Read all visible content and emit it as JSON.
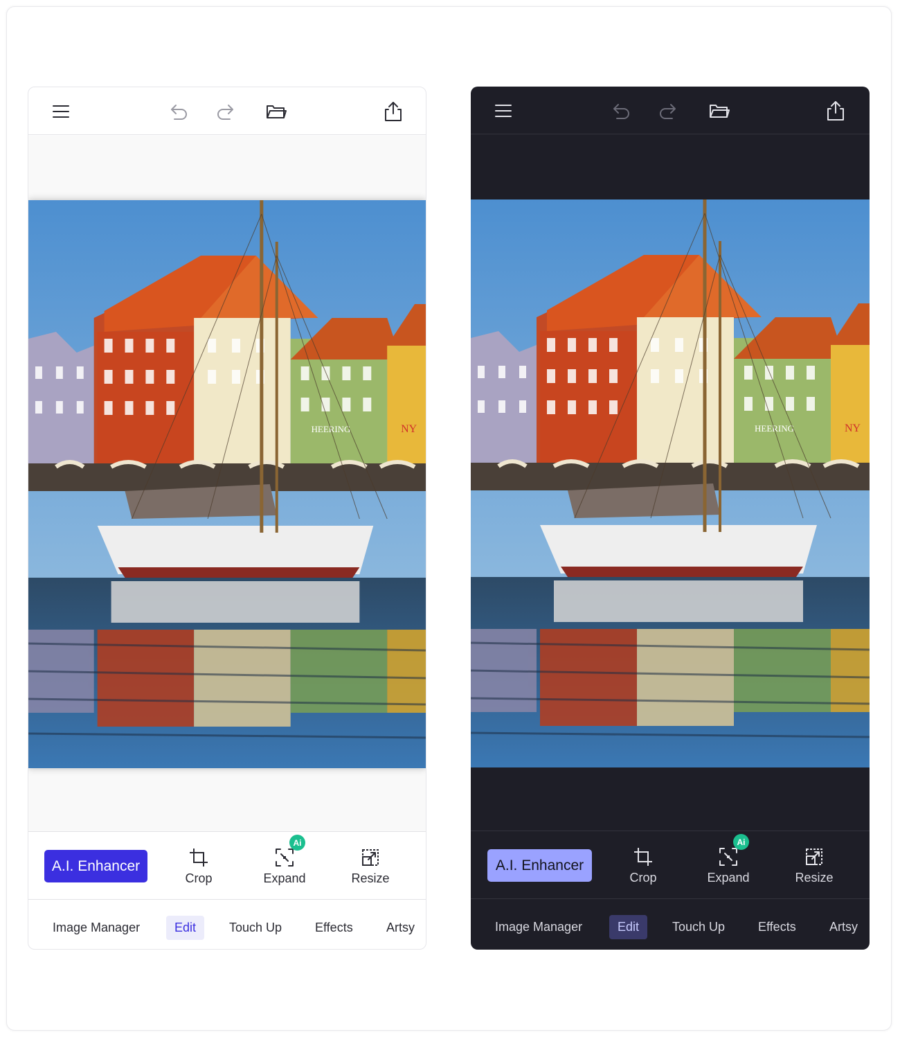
{
  "panels": [
    {
      "theme": "light",
      "icons": [
        "menu-icon",
        "undo-icon",
        "redo-icon",
        "open-folder-icon",
        "share-icon"
      ],
      "ai_enhancer_label": "A.I. Enhancer",
      "tools": [
        {
          "label": "Crop",
          "icon": "crop-icon"
        },
        {
          "label": "Expand",
          "icon": "expand-icon",
          "badge": "Ai"
        },
        {
          "label": "Resize",
          "icon": "resize-icon"
        }
      ],
      "nav": [
        {
          "label": "Image Manager"
        },
        {
          "label": "Edit",
          "active": true
        },
        {
          "label": "Touch Up"
        },
        {
          "label": "Effects"
        },
        {
          "label": "Artsy"
        }
      ],
      "colors": {
        "accent": "#3b2fe0",
        "ai_badge": "#1bbf8f",
        "background": "#ffffff"
      }
    },
    {
      "theme": "dark",
      "icons": [
        "menu-icon",
        "undo-icon",
        "redo-icon",
        "open-folder-icon",
        "share-icon"
      ],
      "ai_enhancer_label": "A.I. Enhancer",
      "tools": [
        {
          "label": "Crop",
          "icon": "crop-icon"
        },
        {
          "label": "Expand",
          "icon": "expand-icon",
          "badge": "Ai"
        },
        {
          "label": "Resize",
          "icon": "resize-icon"
        }
      ],
      "nav": [
        {
          "label": "Image Manager"
        },
        {
          "label": "Edit",
          "active": true
        },
        {
          "label": "Touch Up"
        },
        {
          "label": "Effects"
        },
        {
          "label": "Artsy"
        }
      ],
      "colors": {
        "accent": "#9aa2ff",
        "ai_badge": "#1bbf8f",
        "background": "#1e1e27"
      }
    }
  ],
  "photo": {
    "description_icon": "photo-canvas",
    "sign_texts": [
      "HEERING",
      "NY"
    ]
  }
}
